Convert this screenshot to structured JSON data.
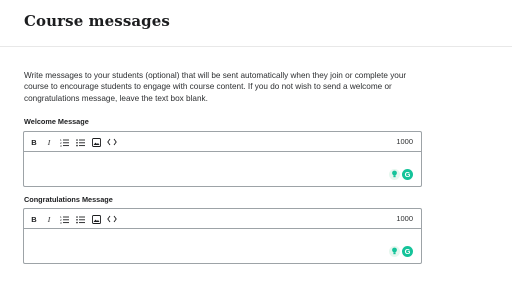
{
  "header": {
    "title": "Course messages"
  },
  "intro": "Write messages to your students (optional) that will be sent automatically when they join or complete your course to encourage students to engage with course content. If you do not wish to send a welcome or congratulations message, leave the text box blank.",
  "welcome": {
    "label": "Welcome Message",
    "char_count": "1000",
    "value": ""
  },
  "congrats": {
    "label": "Congratulations Message",
    "char_count": "1000",
    "value": ""
  },
  "toolbar": {
    "bold": "B",
    "italic": "I",
    "icons": [
      "bold-icon",
      "italic-icon",
      "numbered-list-icon",
      "bullet-list-icon",
      "image-icon",
      "code-icon"
    ]
  },
  "grammarly": {
    "logo": "G",
    "color": "#15c39a"
  },
  "colors": {
    "border": "#9da3a7",
    "text": "#1c1d1f",
    "divider": "#e8e8e8"
  }
}
